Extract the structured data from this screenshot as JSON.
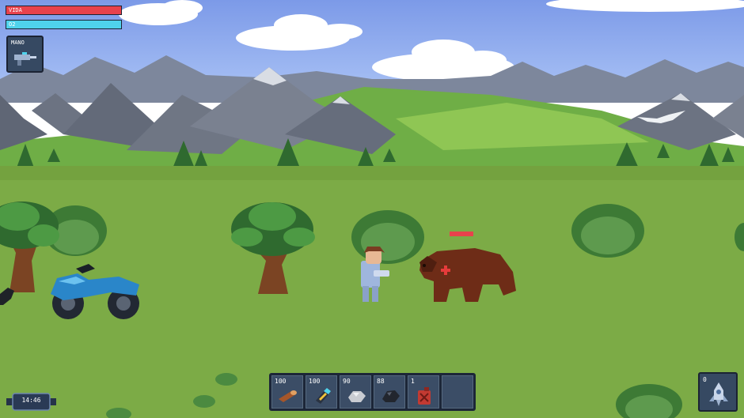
{
  "hud": {
    "health": {
      "label": "VIDA",
      "level": 1.0,
      "color": "#e8424c"
    },
    "oxygen": {
      "label": "O2",
      "level": 1.0,
      "color": "#4fd3ec"
    },
    "weapon": {
      "label": "MANO",
      "icon": "blaster-icon"
    },
    "clock": {
      "time": "14:46"
    },
    "rocket": {
      "count": "0",
      "icon": "rocket-icon"
    }
  },
  "hotbar": [
    {
      "count": "100",
      "icon": "wood-log-icon"
    },
    {
      "count": "100",
      "icon": "energy-cell-icon"
    },
    {
      "count": "90",
      "icon": "iron-ore-icon"
    },
    {
      "count": "88",
      "icon": "coal-icon"
    },
    {
      "count": "1",
      "icon": "fuel-can-icon"
    },
    {
      "count": "",
      "icon": ""
    }
  ],
  "enemy": {
    "name": "bear",
    "health_level": 1.0
  },
  "colors": {
    "sky": "#8aa9ee",
    "grass": "#7cab46",
    "mountain": "#6f7684",
    "hud_panel": "#364962"
  }
}
